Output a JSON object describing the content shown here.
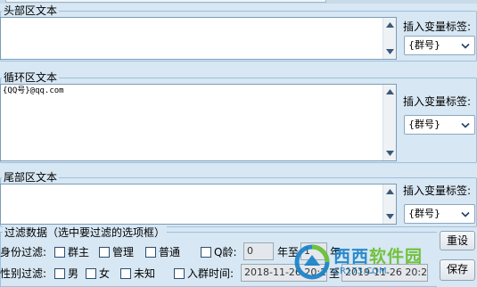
{
  "header_section": {
    "label": "头部区文本",
    "content": "",
    "insert_label": "插入变量标签:",
    "tag_select": "{群号}"
  },
  "loop_section": {
    "label": "循环区文本",
    "content": "{QQ号}@qq.com",
    "insert_label": "插入变量标签:",
    "tag_select": "{群号}"
  },
  "footer_section": {
    "label": "尾部区文本",
    "content": "",
    "insert_label": "插入变量标签:",
    "tag_select": "{群号}"
  },
  "filters": {
    "legend": "过滤数据（选中要过滤的选项框）",
    "identity_label": "身份过滤:",
    "identity_options": [
      "群主",
      "管理",
      "普通"
    ],
    "q_age_label": "Q龄:",
    "q_age_from": "0",
    "q_age_sep": "年至",
    "q_age_to": "1",
    "q_age_unit": "年",
    "gender_label": "性别过滤:",
    "gender_options": [
      "男",
      "女",
      "未知"
    ],
    "join_time_label": "入群时间:",
    "join_time_from": "2018-11-26 20:2",
    "join_time_sep": "至",
    "join_time_to": "2019-11-26 20:2"
  },
  "buttons": {
    "reset": "重设",
    "save": "保存"
  },
  "watermark": {
    "title_a": "西西",
    "title_b": "软件园",
    "url": "CR173.COM"
  },
  "colors": {
    "background": "#d7e7f3",
    "group_border": "#9ec1dc",
    "watermark_blue": "#1b83c9",
    "watermark_green": "#6bbf2f"
  }
}
